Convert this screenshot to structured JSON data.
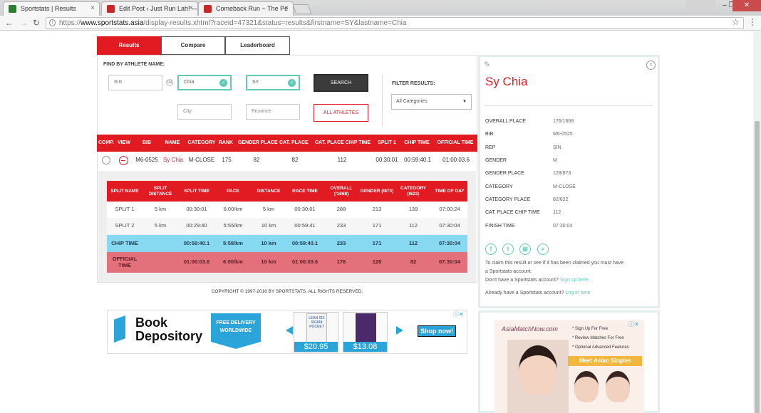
{
  "browser": {
    "tabs": [
      {
        "title": "Sportstats | Results",
        "favicon_color": "#2e7d32"
      },
      {
        "title": "Edit Post ‹ Just Run Lah! —",
        "favicon_color": "#c62828"
      },
      {
        "title": "Comeback Run ~ The Pe",
        "favicon_color": "#c62828"
      }
    ],
    "url_scheme": "https://",
    "url_host": "www.sportstats.asia",
    "url_path": "/display-results.xhtml?raceid=47321&status=results&firstname=SY&lastname=Chia"
  },
  "nav_tabs": [
    "Results",
    "Compare",
    "Leaderboard"
  ],
  "search": {
    "label": "FIND BY ATHLETE NAME:",
    "bib_placeholder": "BIB",
    "or_label": "OR",
    "lastname_value": "Chia",
    "firstname_value": "SY",
    "city_placeholder": "City",
    "province_placeholder": "Province",
    "search_button": "SEARCH",
    "all_athletes_button": "ALL ATHLETES",
    "filter_label": "FILTER RESULTS:",
    "filter_value": "All Categories"
  },
  "results_table": {
    "headers": [
      "COMP.",
      "VIEW",
      "BIB",
      "NAME",
      "CATEGORY",
      "RANK",
      "GENDER PLACE",
      "CAT. PLACE",
      "CAT. PLACE CHIP TIME",
      "SPLIT 1",
      "CHIP TIME",
      "OFFICIAL TIME"
    ],
    "row": {
      "bib": "M6-0525",
      "name": "Sy Chia",
      "category": "M-CLOSE",
      "rank": "175",
      "gender_place": "82",
      "cat_place": "82",
      "cat_place_chip": "112",
      "split1": "00:30:01",
      "chip_time": "00:59:40.1",
      "official_time": "01:00:03.6"
    }
  },
  "split_table": {
    "headers": [
      "SPLIT NAME",
      "SPLIT DISTANCE",
      "SPLIT TIME",
      "PACE",
      "DISTANCE",
      "RACE TIME",
      "OVERALL (/1668)",
      "GENDER (/873)",
      "CATEGORY (/622)",
      "TIME OF DAY"
    ],
    "rows": [
      [
        "SPLIT 1",
        "5 km",
        "00:30:01",
        "6:00/km",
        "5 km",
        "00:30:01",
        "288",
        "213",
        "139",
        "07:00:24"
      ],
      [
        "SPLIT 2",
        "5 km",
        "00:29:40",
        "5:55/km",
        "10 km",
        "00:59:41",
        "233",
        "171",
        "112",
        "07:30:04"
      ],
      [
        "CHIP TIME",
        "",
        "00:59:40.1",
        "5:58/km",
        "10 km",
        "00:59:40.1",
        "233",
        "171",
        "112",
        "07:30:04"
      ],
      [
        "OFFICIAL TIME",
        "",
        "01:00:03.6",
        "6:00/km",
        "10 km",
        "01:00:03.6",
        "176",
        "128",
        "82",
        "07:30:04"
      ]
    ]
  },
  "copyright": "COPYRIGHT © 1997-2016 BY SPORTSTATS. ALL RIGHTS RESERVED.",
  "athlete": {
    "name": "Sy Chia",
    "details": [
      [
        "OVERALL PLACE",
        "176/1668"
      ],
      [
        "BIB",
        "M6-0525"
      ],
      [
        "REP",
        "SIN"
      ],
      [
        "GENDER",
        "M"
      ],
      [
        "GENDER PLACE",
        "128/873"
      ],
      [
        "CATEGORY",
        "M-CLOSE"
      ],
      [
        "CATEGORY PLACE",
        "82/622"
      ],
      [
        "CAT. PLACE CHIP TIME",
        "112"
      ],
      [
        "FINISH TIME",
        "07:30:04"
      ]
    ],
    "claim_text_1": "To claim this result or see if it has been claimed you must have",
    "claim_text_2": "a Sportstats account.",
    "no_account_text": "Don't have a Sportstats account?",
    "signup_link": "Sign up here",
    "have_account_text": "Already have a Sportstats account?",
    "login_link": "Log in here"
  },
  "ad_bookdepository": {
    "logo_line1": "Book",
    "logo_line2": "Depository",
    "free_delivery": "FREE DELIVERY WORLDWIDE",
    "book1_title": "LEAN SIX SIGMA POCKET",
    "book1_price": "$20.95",
    "book2_price": "$13.08",
    "shop_now": "Shop now!"
  },
  "ad_asiamatch": {
    "logo": "AsiaMatchNow.com",
    "features": [
      "Sign Up For Free",
      "Review Matches For Free",
      "Optional Advanced Features"
    ],
    "banner": "Meet Asian Singles"
  },
  "colors": {
    "brand_red": "#e21b23",
    "accent_teal": "#5fcbb4",
    "chip_row": "#86d9f0",
    "official_row": "#e4707c"
  }
}
